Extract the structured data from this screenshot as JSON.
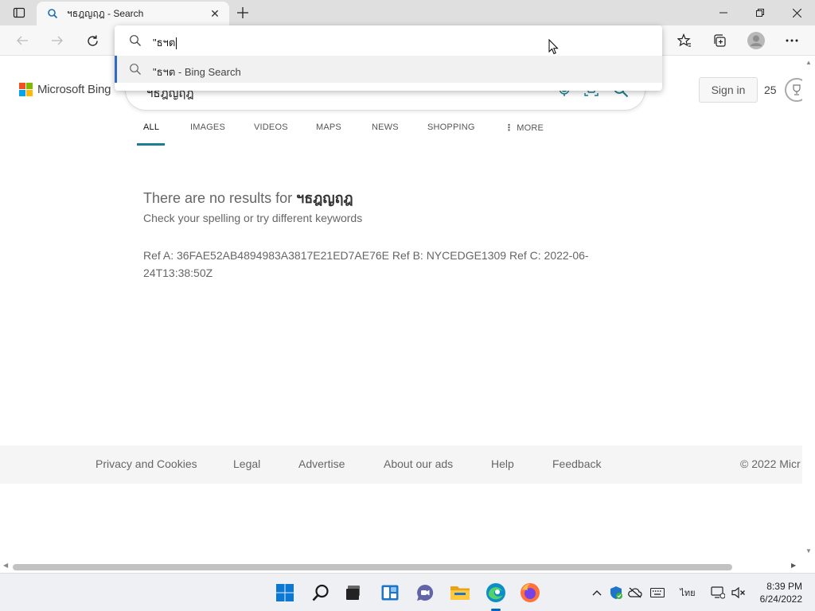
{
  "browser": {
    "tab": {
      "title": "ฯธฎญฤฎ - Search"
    },
    "window_controls": [
      "minimize",
      "restore",
      "close"
    ]
  },
  "omnibox": {
    "typed_text": "\"ธฯต",
    "suggestion": {
      "query": "\"ธฯต",
      "suffix": " - Bing Search"
    }
  },
  "page": {
    "logo_text": "Microsoft Bing",
    "logo_colors": [
      "#f25022",
      "#7fba00",
      "#00a4ef",
      "#ffb900"
    ],
    "search_query": "ฯธฎญฤฎ",
    "sign_in_label": "Sign in",
    "rewards_points": "25",
    "scopes": [
      "ALL",
      "IMAGES",
      "VIDEOS",
      "MAPS",
      "NEWS",
      "SHOPPING",
      "MORE"
    ],
    "active_scope": "ALL",
    "accent_color": "#1a7f8e",
    "no_results_prefix": "There are no results for ",
    "no_results_query": "ฯธฎญฤฎ",
    "no_results_hint": "Check your spelling or try different keywords",
    "reference": "Ref A: 36FAE52AB4894983A3817E21ED7AE76E Ref B: NYCEDGE1309 Ref C: 2022-06-24T13:38:50Z",
    "footer_links": [
      "Privacy and Cookies",
      "Legal",
      "Advertise",
      "About our ads",
      "Help",
      "Feedback"
    ],
    "copyright": "© 2022 Micr"
  },
  "taskbar": {
    "apps": [
      "windows-start-icon",
      "search-icon",
      "task-view-icon",
      "widgets-icon",
      "teams-chat-icon",
      "file-explorer-icon",
      "edge-icon",
      "firefox-icon"
    ],
    "input_language": "ไทย",
    "time": "8:39 PM",
    "date": "6/24/2022"
  }
}
